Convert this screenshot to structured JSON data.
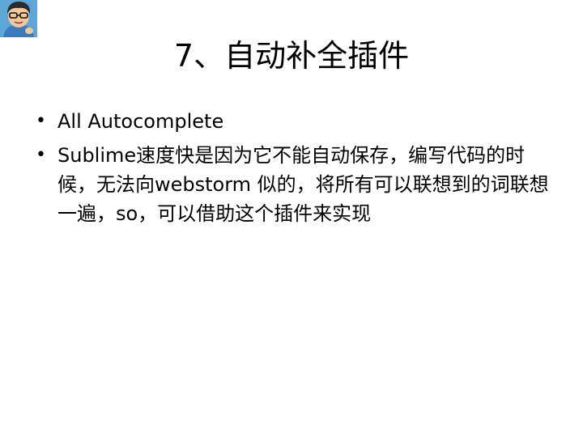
{
  "slide": {
    "title": "7、自动补全插件",
    "avatar_icon": "cartoon-avatar-icon",
    "bullets": [
      {
        "text": "All Autocomplete"
      },
      {
        "text": "Sublime速度快是因为它不能自动保存，编写代码的时候，无法向webstorm 似的，将所有可以联想到的词联想一遍，so，可以借助这个插件来实现"
      }
    ]
  },
  "colors": {
    "text": "#000000",
    "background": "#ffffff",
    "avatar_bg": "#5aa7d8",
    "avatar_skin": "#f2c89b",
    "avatar_hair": "#2b2b2b"
  }
}
